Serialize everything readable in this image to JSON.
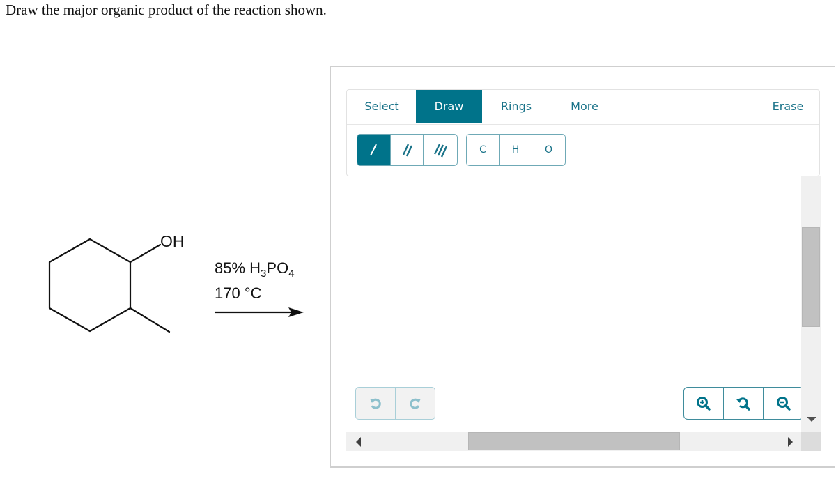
{
  "question": {
    "prompt": "Draw the major organic product of the reaction shown."
  },
  "reaction": {
    "reactant": "2-methylcyclohexanol",
    "substituent_label": "OH",
    "reagent_line1_prefix": "85% H",
    "reagent_line1_sub1": "3",
    "reagent_line1_mid": "PO",
    "reagent_line1_sub2": "4",
    "reagent_line2": "170 °C",
    "arrow": "reaction-arrow"
  },
  "editor": {
    "tabs": [
      {
        "label": "Select",
        "active": false
      },
      {
        "label": "Draw",
        "active": true
      },
      {
        "label": "Rings",
        "active": false
      },
      {
        "label": "More",
        "active": false
      },
      {
        "label": "Erase",
        "active": false
      }
    ],
    "bond_tools": [
      {
        "name": "single-bond",
        "active": true
      },
      {
        "name": "double-bond",
        "active": false
      },
      {
        "name": "triple-bond",
        "active": false
      }
    ],
    "atom_tools": [
      {
        "label": "C"
      },
      {
        "label": "H"
      },
      {
        "label": "O"
      }
    ],
    "history_tools": [
      {
        "name": "undo-icon"
      },
      {
        "name": "redo-icon"
      }
    ],
    "zoom_tools": [
      {
        "name": "zoom-in-icon"
      },
      {
        "name": "reset-zoom-icon"
      },
      {
        "name": "zoom-out-icon"
      }
    ],
    "accent_color": "#00738a",
    "scroll": {
      "vertical_thumb_start": 0.2,
      "vertical_thumb_end": 0.59,
      "horizontal_thumb_start": 0.268,
      "horizontal_thumb_end": 0.734
    }
  }
}
